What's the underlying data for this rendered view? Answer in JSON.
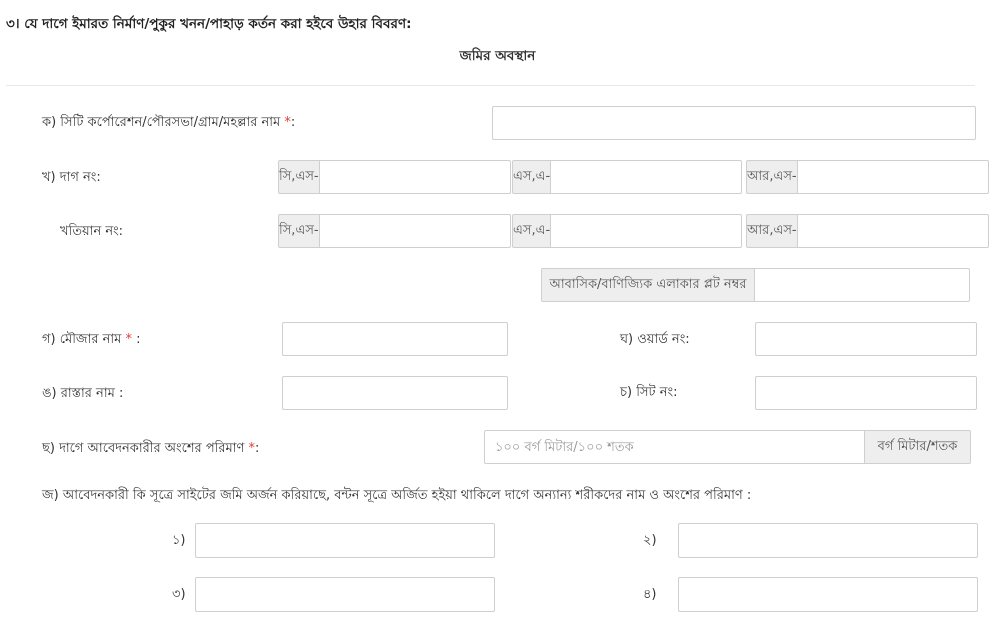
{
  "header": {
    "section_title": "৩। যে দাগে ইমারত নির্মাণ/পুকুর খনন/পাহাড় কর্তন করা হইবে উহার বিবরণ:",
    "subtitle": "জমির অবস্থান"
  },
  "form": {
    "city_label": "ক) সিটি কর্পোরেশন/পৌরসভা/গ্রাম/মহল্লার নাম",
    "required_mark": "*",
    "city_colon": ":",
    "dag_label": "খ) দাগ নং:",
    "khatian_label": "খতিয়ান নং:",
    "prefix_cs": "সি,এস-",
    "prefix_sa": "এস,এ-",
    "prefix_rs": "আর,এস-",
    "plot_label": "আবাসিক/বাণিজ্যিক এলাকার প্লট নম্বর",
    "mouza_label": "গ) মৌজার নাম",
    "mouza_colon": ":",
    "ward_label": "ঘ) ওয়ার্ড নং:",
    "road_label": "ঙ) রাস্তার নাম :",
    "sheet_label": "চ) সিট নং:",
    "share_label": "ছ) দাগে আবেদনকারীর অংশের পরিমাণ",
    "share_colon": ":",
    "share_placeholder": "১০০ বর্গ মিটার/১০০ শতক",
    "share_unit": "বর্গ মিটার/শতক",
    "acquire_label": "জ) আবেদনকারী কি সূত্রে সাইটের জমি অর্জন করিয়াছে, বন্টন সূত্রে অর্জিত হইয়া থাকিলে দাগে অন্যান্য শরীকদের নাম ও অংশের পরিমাণ :",
    "n1": "১)",
    "n2": "২)",
    "n3": "৩)",
    "n4": "৪)"
  }
}
